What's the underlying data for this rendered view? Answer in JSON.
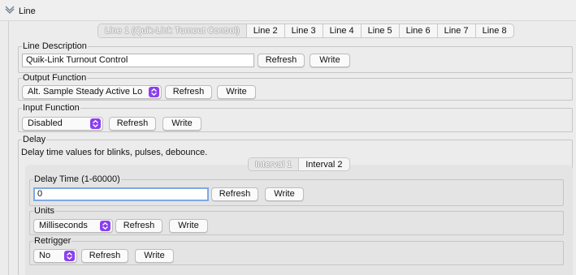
{
  "header": {
    "title": "Line",
    "icon": "chevron-down-icon"
  },
  "tabs": [
    {
      "label": "Line 1 (Quik-Link Turnout Control)",
      "selected": true
    },
    {
      "label": "Line 2"
    },
    {
      "label": "Line 3"
    },
    {
      "label": "Line 4"
    },
    {
      "label": "Line 5"
    },
    {
      "label": "Line 6"
    },
    {
      "label": "Line 7"
    },
    {
      "label": "Line 8"
    }
  ],
  "line_description": {
    "legend": "Line Description",
    "value": "Quik-Link Turnout Control",
    "refresh": "Refresh",
    "write": "Write"
  },
  "output_function": {
    "legend": "Output Function",
    "selected": "Alt. Sample Steady Active Lo",
    "refresh": "Refresh",
    "write": "Write"
  },
  "input_function": {
    "legend": "Input Function",
    "selected": "Disabled",
    "refresh": "Refresh",
    "write": "Write"
  },
  "delay": {
    "legend": "Delay",
    "description": "Delay time values for blinks, pulses, debounce.",
    "subtabs": [
      {
        "label": "Interval 1",
        "selected": true
      },
      {
        "label": "Interval 2"
      }
    ],
    "delay_time": {
      "legend": "Delay Time (1-60000)",
      "value": "0",
      "refresh": "Refresh",
      "write": "Write"
    },
    "units": {
      "legend": "Units",
      "selected": "Milliseconds",
      "refresh": "Refresh",
      "write": "Write"
    },
    "retrigger": {
      "legend": "Retrigger",
      "selected": "No",
      "refresh": "Refresh",
      "write": "Write"
    }
  },
  "colors": {
    "accent": "#8b3ff0",
    "focus": "#7ea9e6"
  }
}
